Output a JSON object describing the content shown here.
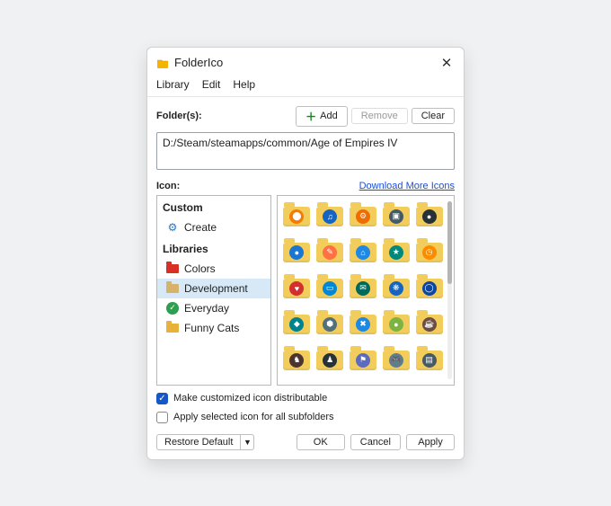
{
  "title": "FolderIco",
  "menu": [
    "Library",
    "Edit",
    "Help"
  ],
  "folders_label": "Folder(s):",
  "buttons": {
    "add": "Add",
    "remove": "Remove",
    "clear": "Clear"
  },
  "path": "D:/Steam/steamapps/common/Age of Empires IV",
  "icon_label": "Icon:",
  "download_link": "Download More Icons",
  "tree": {
    "custom_title": "Custom",
    "create": "Create",
    "libraries_title": "Libraries",
    "items": [
      {
        "label": "Colors",
        "icon": "folder-red",
        "selected": false
      },
      {
        "label": "Development",
        "icon": "folder-tan",
        "selected": true
      },
      {
        "label": "Everyday",
        "icon": "check",
        "selected": false
      },
      {
        "label": "Funny Cats",
        "icon": "folder-tan-sat",
        "selected": false
      }
    ]
  },
  "grid_badges": [
    {
      "bg": "#f57c00",
      "g": "⬤"
    },
    {
      "bg": "#1565c0",
      "g": "♫"
    },
    {
      "bg": "#ef6c00",
      "g": "⚙"
    },
    {
      "bg": "#455a64",
      "g": "▣"
    },
    {
      "bg": "#263238",
      "g": "●"
    },
    {
      "bg": "#1976d2",
      "g": "●"
    },
    {
      "bg": "#ff7043",
      "g": "✎"
    },
    {
      "bg": "#1e88e5",
      "g": "⌂"
    },
    {
      "bg": "#00897b",
      "g": "★"
    },
    {
      "bg": "#fb8c00",
      "g": "◷"
    },
    {
      "bg": "#d32f2f",
      "g": "♥"
    },
    {
      "bg": "#0288d1",
      "g": "▭"
    },
    {
      "bg": "#00695c",
      "g": "✉"
    },
    {
      "bg": "#1565c0",
      "g": "❋"
    },
    {
      "bg": "#0d47a1",
      "g": "◯"
    },
    {
      "bg": "#00838f",
      "g": "◆"
    },
    {
      "bg": "#546e7a",
      "g": "⬢"
    },
    {
      "bg": "#1e88e5",
      "g": "✖"
    },
    {
      "bg": "#7cb342",
      "g": "●"
    },
    {
      "bg": "#6d4c41",
      "g": "☕"
    },
    {
      "bg": "#4e342e",
      "g": "♞"
    },
    {
      "bg": "#263238",
      "g": "♟"
    },
    {
      "bg": "#5c6bc0",
      "g": "⚑"
    },
    {
      "bg": "#607d8b",
      "g": "🎮"
    },
    {
      "bg": "#455a64",
      "g": "▤"
    },
    {
      "bg": "#999",
      "g": ""
    },
    {
      "bg": "#999",
      "g": ""
    },
    {
      "bg": "#999",
      "g": ""
    },
    {
      "bg": "#999",
      "g": ""
    },
    {
      "bg": "#999",
      "g": ""
    }
  ],
  "checkboxes": {
    "dist": "Make customized icon distributable",
    "sub": "Apply selected icon for all subfolders"
  },
  "footer": {
    "restore": "Restore Default",
    "ok": "OK",
    "cancel": "Cancel",
    "apply": "Apply"
  }
}
